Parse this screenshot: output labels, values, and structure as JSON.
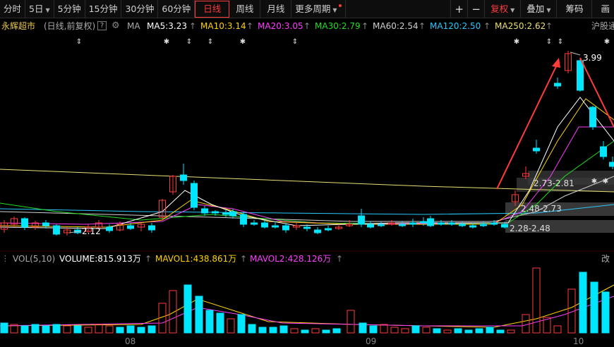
{
  "toolbar": {
    "periods": [
      "分时",
      "5日",
      "5分钟",
      "15分钟",
      "30分钟",
      "60分钟",
      "日线",
      "周线",
      "月线",
      "更多周期"
    ],
    "active_period": "日线",
    "plus_icon": "plus-icon",
    "minus_icon": "minus-icon",
    "fuquan_label": "复权",
    "overlay_label": "叠加",
    "chips_label": "筹码",
    "draw_label": "画"
  },
  "stock": {
    "name": "永辉超市",
    "mode": "(日线,前复权)",
    "help": "?",
    "ma_label": "MA"
  },
  "ma": [
    {
      "label": "MA5:3.23",
      "color": "#ffffff"
    },
    {
      "label": "MA10:3.14",
      "color": "#ffd200"
    },
    {
      "label": "MA20:3.05",
      "color": "#ff3cff"
    },
    {
      "label": "MA30:2.79",
      "color": "#22dd22"
    },
    {
      "label": "MA60:2.54",
      "color": "#cfcfcf"
    },
    {
      "label": "MA120:2.50",
      "color": "#28c8ff"
    },
    {
      "label": "MA250:2.62",
      "color": "#e8e070"
    }
  ],
  "index_label": "沪股通",
  "vol": {
    "label": "VOL(5,10)",
    "volume": "VOLUME:815.913万",
    "mavol1": "MAVOL1:438.861万",
    "mavol2": "MAVOL2:428.126万",
    "right_label": "改"
  },
  "chart": {
    "high_label": "3.99",
    "low_label": "2.12",
    "chips": [
      "2.73-2.81",
      "2.48-2.73",
      "2.28-2.48"
    ],
    "x_labels": [
      "08",
      "09",
      "10"
    ],
    "up_color": "#ff3b3b",
    "down_color": "#00e6ff"
  }
}
